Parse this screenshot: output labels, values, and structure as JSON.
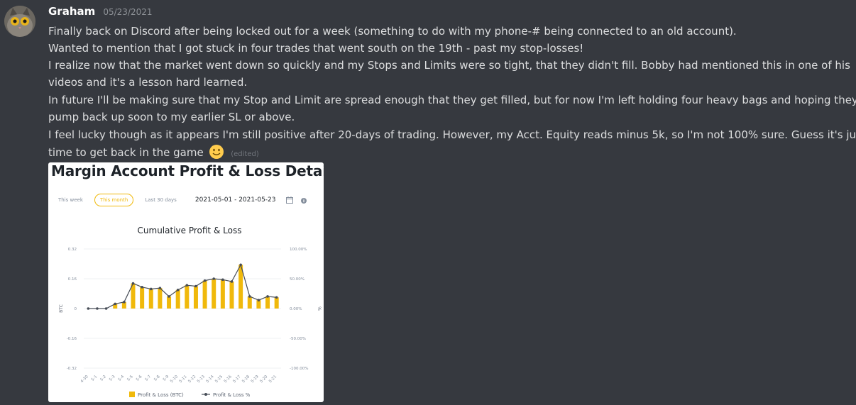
{
  "message": {
    "author": "Graham",
    "timestamp": "05/23/2021",
    "avatar_icon": "cat-avatar-icon",
    "lines": [
      "Finally back on Discord after being locked out for a week (something to do with my phone-# being connected to an old account).",
      "Wanted to mention that I got stuck in four trades that went south on the 19th  - past my stop-losses!",
      "I realize now that the market went down so quickly and my Stops and Limits were so tight, that they didn't fill. Bobby had mentioned this in one of his",
      "videos and it's a lesson hard learned.",
      "In future I'll be making sure that my Stop and Limit are spread enough that they get filled, but for now I'm left holding four heavy bags and hoping they",
      "pump back up soon to my earlier SL or above.",
      "I feel lucky though as it appears I'm still positive after 20-days of trading. However, my Acct. Equity reads minus 5k, so I'm not 100% sure. Guess it's just",
      "time to get back in the game"
    ],
    "emoji": "slightly-smiling-face-icon",
    "edited_label": "(edited)"
  },
  "attachment": {
    "title": "Margin Account Profit & Loss Details",
    "tabs": [
      "This week",
      "This month",
      "Last 30 days"
    ],
    "active_tab": "This month",
    "date_range": "2021-05-01 - 2021-05-23",
    "calendar_icon": "calendar-icon",
    "info_icon": "info-icon"
  },
  "chart_data": {
    "type": "bar+line",
    "title": "Cumulative Profit & Loss",
    "xlabel": "",
    "ylabel_left": "BTC",
    "ylabel_right": "%",
    "categories": [
      "4-30",
      "5-1",
      "5-2",
      "5-3",
      "5-4",
      "5-5",
      "5-6",
      "5-7",
      "5-8",
      "5-9",
      "5-10",
      "5-11",
      "5-12",
      "5-13",
      "5-14",
      "5-15",
      "5-16",
      "5-17",
      "5-18",
      "5-19",
      "5-20",
      "5-21"
    ],
    "y_left_ticks": [
      "0.32",
      "0.16",
      "0",
      "-0.16",
      "-0.32"
    ],
    "y_right_ticks": [
      "100.00%",
      "50.00%",
      "0.00%",
      "-50.00%",
      "-100.00%"
    ],
    "ylim_left": [
      -0.32,
      0.32
    ],
    "ylim_right": [
      -100,
      100
    ],
    "series": [
      {
        "name": "Profit & Loss (BTC)",
        "kind": "bar",
        "color": "#f0b90b",
        "values": [
          0,
          0,
          0,
          0.025,
          0.035,
          0.135,
          0.115,
          0.105,
          0.11,
          0.065,
          0.1,
          0.125,
          0.12,
          0.15,
          0.16,
          0.155,
          0.145,
          0.235,
          0.065,
          0.045,
          0.065,
          0.06
        ]
      },
      {
        "name": "Profit & Loss %",
        "kind": "line",
        "color": "#474d57",
        "values": [
          0,
          0,
          0,
          0,
          0,
          0,
          0,
          0,
          0,
          0,
          0,
          0,
          0,
          0,
          0,
          0,
          0,
          0,
          0,
          0,
          0,
          0
        ]
      }
    ],
    "grid": true,
    "legend_position": "bottom"
  }
}
